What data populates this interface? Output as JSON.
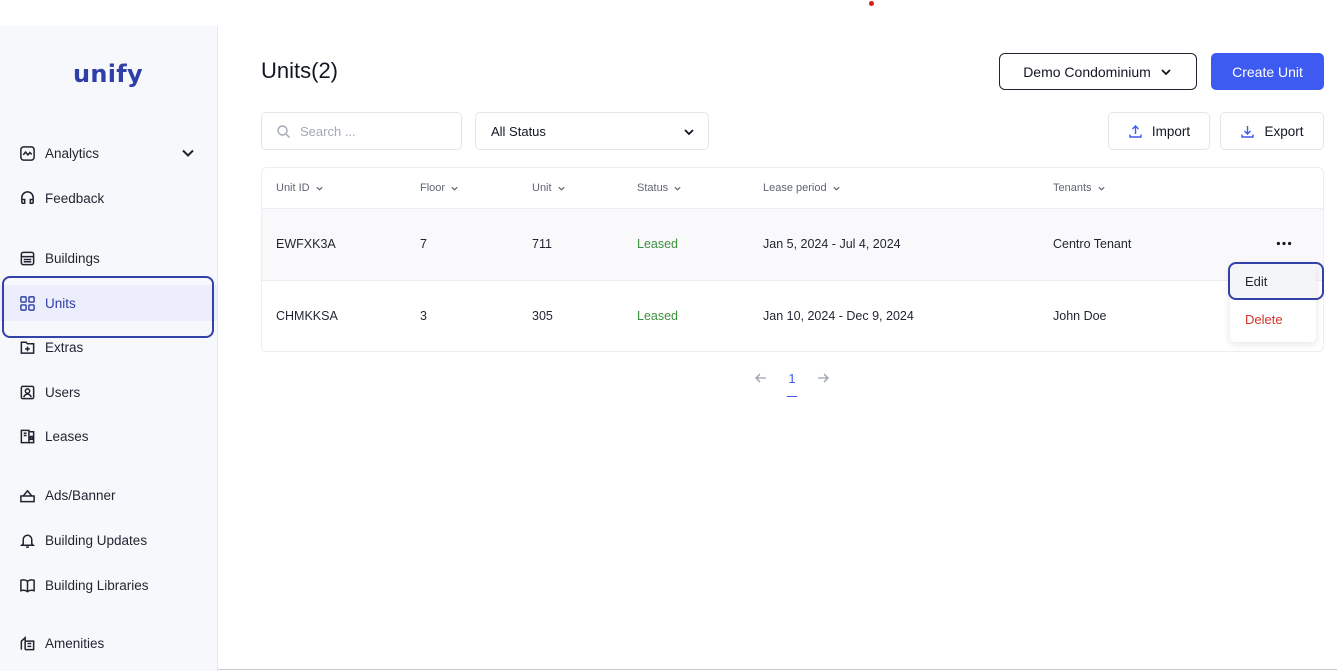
{
  "brand": {
    "logo_text": "unify",
    "color": "#2f3fa8"
  },
  "sidebar": {
    "items": [
      {
        "label": "Analytics",
        "icon": "chart-line-icon",
        "has_chevron": true
      },
      {
        "label": "Feedback",
        "icon": "feedback-icon"
      },
      {
        "label": "Buildings",
        "icon": "building-icon"
      },
      {
        "label": "Units",
        "icon": "grid-icon",
        "active": true
      },
      {
        "label": "Extras",
        "icon": "plus-box-icon"
      },
      {
        "label": "Users",
        "icon": "user-icon"
      },
      {
        "label": "Leases",
        "icon": "lease-icon"
      },
      {
        "label": "Ads/Banner",
        "icon": "banner-icon"
      },
      {
        "label": "Building Updates",
        "icon": "bell-icon"
      },
      {
        "label": "Building Libraries",
        "icon": "book-icon"
      },
      {
        "label": "Amenities",
        "icon": "amenities-icon"
      }
    ]
  },
  "header": {
    "title": "Units(2)",
    "building_selector": "Demo Condominium",
    "create_button": "Create Unit"
  },
  "toolbar": {
    "search_placeholder": "Search ...",
    "status_filter": "All Status",
    "import_label": "Import",
    "export_label": "Export"
  },
  "table": {
    "columns": [
      "Unit ID",
      "Floor",
      "Unit",
      "Status",
      "Lease period",
      "Tenants"
    ],
    "rows": [
      {
        "unit_id": "EWFXK3A",
        "floor": "7",
        "unit": "711",
        "status": "Leased",
        "lease_period": "Jan 5, 2024 - Jul 4, 2024",
        "tenants": "Centro Tenant"
      },
      {
        "unit_id": "CHMKKSA",
        "floor": "3",
        "unit": "305",
        "status": "Leased",
        "lease_period": "Jan 10, 2024 - Dec 9, 2024",
        "tenants": "John Doe"
      }
    ]
  },
  "pagination": {
    "current_page": "1"
  },
  "context_menu": {
    "edit_label": "Edit",
    "delete_label": "Delete"
  },
  "colors": {
    "primary": "#3d5af1",
    "status_leased": "#3f8f3f",
    "danger": "#d3352a",
    "highlight": "#3341a9"
  }
}
